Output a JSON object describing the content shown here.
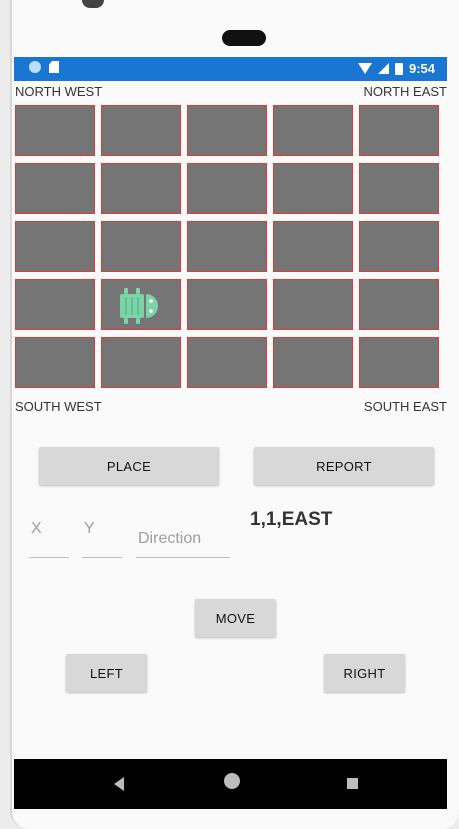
{
  "status_bar": {
    "time": "9:54",
    "color": "#1976d2",
    "icons": [
      "notification-dot-icon",
      "sd-card-icon",
      "wifi-icon",
      "signal-icon",
      "battery-icon"
    ]
  },
  "board": {
    "corners": {
      "north_west": "NORTH WEST",
      "north_east": "NORTH EAST",
      "south_west": "SOUTH WEST",
      "south_east": "SOUTH EAST"
    },
    "rows": 5,
    "cols": 5,
    "cell_color": "#757575",
    "cell_border_color": "#e53935",
    "robot": {
      "icon": "android-robot-icon",
      "row": 3,
      "col": 1,
      "facing": "EAST"
    }
  },
  "controls": {
    "place_label": "PLACE",
    "report_label": "REPORT",
    "move_label": "MOVE",
    "left_label": "LEFT",
    "right_label": "RIGHT"
  },
  "inputs": {
    "x": {
      "value": "",
      "placeholder": "X"
    },
    "y": {
      "value": "",
      "placeholder": "Y"
    },
    "direction": {
      "value": "",
      "placeholder": "Direction"
    }
  },
  "report_output": "1,1,EAST",
  "nav_bar": {
    "icons": [
      "back-icon",
      "home-icon",
      "recents-icon"
    ]
  }
}
